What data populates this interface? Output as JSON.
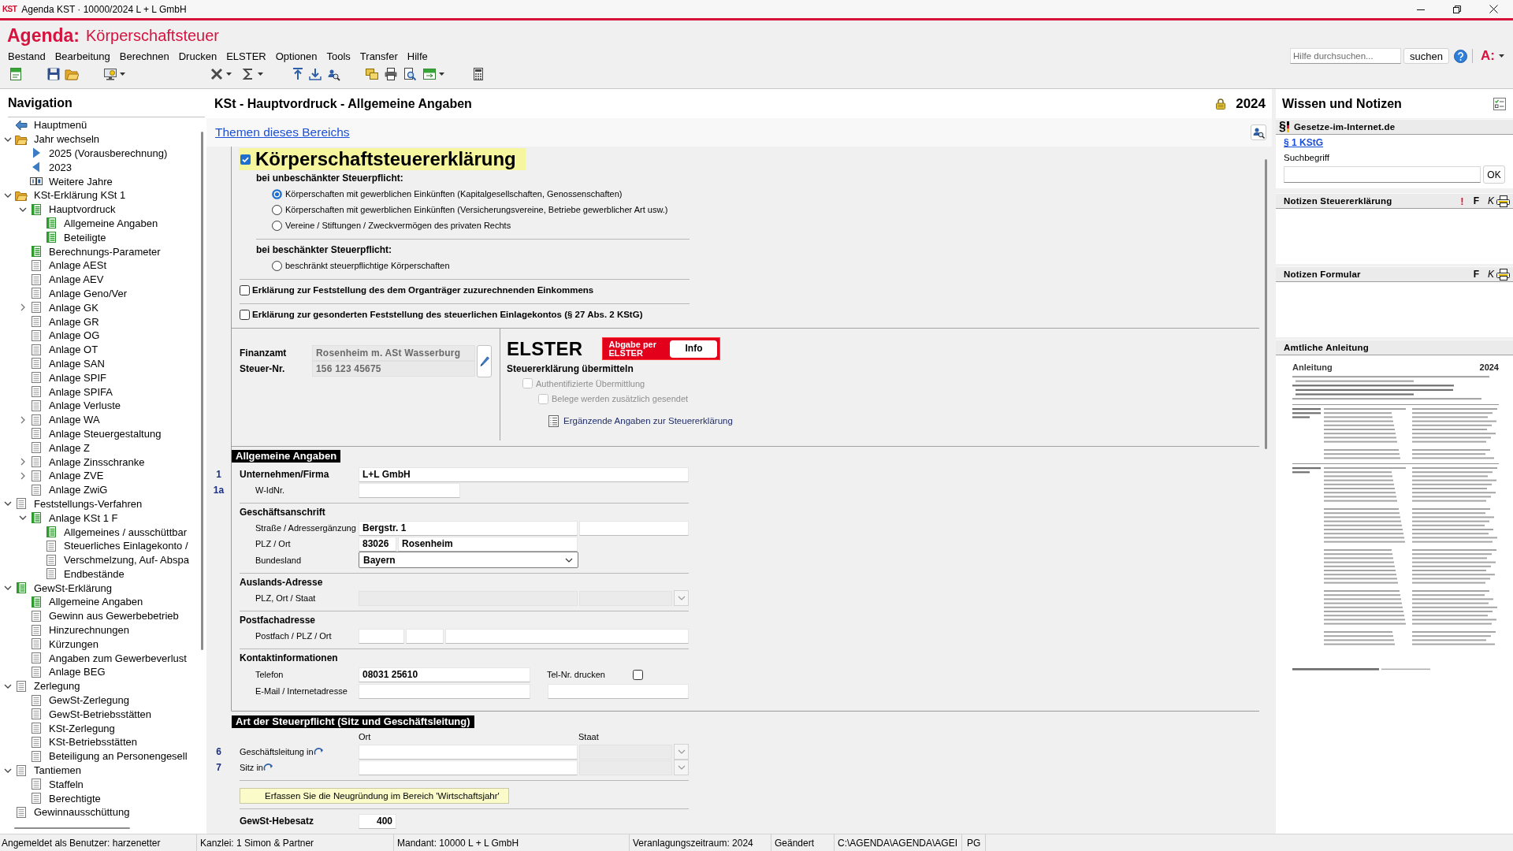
{
  "window": {
    "badge": "KST",
    "title": "Agenda KST · 10000/2024 L + L GmbH"
  },
  "header": {
    "brand": "Agenda:",
    "product": "Körperschaftsteuer",
    "menu": [
      "Bestand",
      "Bearbeitung",
      "Berechnen",
      "Drucken",
      "ELSTER",
      "Optionen",
      "Tools",
      "Transfer",
      "Hilfe"
    ],
    "help_search": {
      "placeholder": "Hilfe durchsuchen...",
      "button": "suchen"
    },
    "account_badge": "A:"
  },
  "navigation": {
    "title": "Navigation",
    "items": [
      {
        "label": "Hauptmenü",
        "kind": "back"
      },
      {
        "label": "Jahr wechseln",
        "kind": "folder",
        "expanded": true,
        "children": [
          {
            "label": "2025 (Vorausberechnung)",
            "kind": "next"
          },
          {
            "label": "2023",
            "kind": "previous"
          },
          {
            "label": "Weitere Jahre",
            "kind": "years"
          }
        ]
      },
      {
        "label": "KSt-Erklärung KSt 1",
        "kind": "folder",
        "expanded": true,
        "children": [
          {
            "label": "Hauptvordruck",
            "kind": "form",
            "filled": true,
            "expanded": true,
            "children": [
              {
                "label": "Allgemeine Angaben",
                "kind": "form",
                "filled": true
              },
              {
                "label": "Beteiligte",
                "kind": "form",
                "filled": true
              }
            ]
          },
          {
            "label": "Berechnungs-Parameter",
            "kind": "form",
            "filled": true
          },
          {
            "label": "Anlage AESt",
            "kind": "form",
            "filled": false
          },
          {
            "label": "Anlage AEV",
            "kind": "form",
            "filled": false
          },
          {
            "label": "Anlage Geno/Ver",
            "kind": "form",
            "filled": false
          },
          {
            "label": "Anlage GK",
            "kind": "form",
            "filled": false,
            "expanded": false
          },
          {
            "label": "Anlage GR",
            "kind": "form",
            "filled": false
          },
          {
            "label": "Anlage OG",
            "kind": "form",
            "filled": false
          },
          {
            "label": "Anlage OT",
            "kind": "form",
            "filled": false
          },
          {
            "label": "Anlage SAN",
            "kind": "form",
            "filled": false
          },
          {
            "label": "Anlage SPIF",
            "kind": "form",
            "filled": false
          },
          {
            "label": "Anlage SPIFA",
            "kind": "form",
            "filled": false
          },
          {
            "label": "Anlage Verluste",
            "kind": "form",
            "filled": false
          },
          {
            "label": "Anlage WA",
            "kind": "form",
            "filled": false,
            "expanded": false
          },
          {
            "label": "Anlage Steuergestaltung",
            "kind": "form",
            "filled": false
          },
          {
            "label": "Anlage Z",
            "kind": "form",
            "filled": false
          },
          {
            "label": "Anlage Zinsschranke",
            "kind": "form",
            "filled": false,
            "expanded": false
          },
          {
            "label": "Anlage ZVE",
            "kind": "form",
            "filled": false,
            "expanded": false
          },
          {
            "label": "Anlage ZwiG",
            "kind": "form",
            "filled": false
          }
        ]
      },
      {
        "label": "Feststellungs-Verfahren",
        "kind": "form",
        "filled": false,
        "expanded": true,
        "children": [
          {
            "label": "Anlage KSt 1 F",
            "kind": "form",
            "filled": true,
            "expanded": true,
            "children": [
              {
                "label": "Allgemeines / ausschüttbar",
                "kind": "form",
                "filled": true
              },
              {
                "label": "Steuerliches Einlagekonto /",
                "kind": "form",
                "filled": false
              },
              {
                "label": "Verschmelzung, Auf- Abspa",
                "kind": "form",
                "filled": false
              },
              {
                "label": "Endbestände",
                "kind": "form",
                "filled": false
              }
            ]
          }
        ]
      },
      {
        "label": "GewSt-Erklärung",
        "kind": "form",
        "filled": true,
        "expanded": true,
        "children": [
          {
            "label": "Allgemeine Angaben",
            "kind": "form",
            "filled": true
          },
          {
            "label": "Gewinn aus Gewerbebetrieb",
            "kind": "form",
            "filled": false
          },
          {
            "label": "Hinzurechnungen",
            "kind": "form",
            "filled": false
          },
          {
            "label": "Kürzungen",
            "kind": "form",
            "filled": false
          },
          {
            "label": "Angaben zum Gewerbeverlust",
            "kind": "form",
            "filled": false
          },
          {
            "label": "Anlage BEG",
            "kind": "form",
            "filled": false
          }
        ]
      },
      {
        "label": "Zerlegung",
        "kind": "form",
        "filled": false,
        "expanded": true,
        "children": [
          {
            "label": "GewSt-Zerlegung",
            "kind": "form",
            "filled": false
          },
          {
            "label": "GewSt-Betriebsstätten",
            "kind": "form",
            "filled": false
          },
          {
            "label": "KSt-Zerlegung",
            "kind": "form",
            "filled": false
          },
          {
            "label": "KSt-Betriebsstätten",
            "kind": "form",
            "filled": false
          },
          {
            "label": "Beteiligung an Personengesell",
            "kind": "form",
            "filled": false
          }
        ]
      },
      {
        "label": "Tantiemen",
        "kind": "form",
        "filled": false,
        "expanded": true,
        "children": [
          {
            "label": "Staffeln",
            "kind": "form",
            "filled": false
          },
          {
            "label": "Berechtigte",
            "kind": "form",
            "filled": false
          }
        ]
      },
      {
        "label": "Gewinnausschüttung",
        "kind": "form",
        "filled": false
      }
    ]
  },
  "form": {
    "title": "KSt - Hauptvordruck - Allgemeine Angaben",
    "locked": true,
    "year": "2024",
    "topics_link": "Themen dieses Bereichs",
    "declaration": {
      "checked": true,
      "title": "Körperschaftsteuererklärung",
      "groups": [
        {
          "heading": "bei unbeschänkter Steuerpflicht:",
          "options": [
            {
              "label": "Körperschaften mit gewerblichen Einkünften (Kapitalgesellschaften, Genossenschaften)",
              "selected": true
            },
            {
              "label": "Körperschaften mit gewerblichen Einkünften (Versicherungsvereine, Betriebe gewerblicher Art usw.)",
              "selected": false
            },
            {
              "label": "Vereine / Stiftungen / Zweckvermögen des privaten Rechts",
              "selected": false
            }
          ]
        },
        {
          "heading": "bei beschänkter Steuerpflicht:",
          "options": [
            {
              "label": "beschränkt steuerpflichtige Körperschaften",
              "selected": false
            }
          ]
        }
      ],
      "additional": [
        {
          "label": "Erklärung zur Feststellung des dem Organträger zuzurechnenden Einkommens",
          "checked": false
        },
        {
          "label": "Erklärung zur gesonderten Feststellung des steuerlichen Einlagekontos (§ 27 Abs. 2 KStG)",
          "checked": false
        }
      ]
    },
    "tax_office": [
      {
        "label": "Finanzamt",
        "value": "Rosenheim m. ASt Wasserburg"
      },
      {
        "label": "Steuer-Nr.",
        "value": "156 123 45675"
      }
    ],
    "elster": {
      "logo": "ELSTER",
      "submit_button": "Abgabe per ELSTER",
      "info_button": "Info",
      "heading": "Steuererklärung übermitteln",
      "options": [
        {
          "label": "Authentifizierte Übermittlung",
          "checked": false,
          "disabled": true,
          "children": [
            {
              "label": "Belege werden zusätzlich gesendet",
              "checked": false,
              "disabled": true
            }
          ]
        }
      ],
      "link": "Ergänzende Angaben zur Steuererklärung"
    },
    "sections": [
      {
        "title": "Allgemeine Angaben",
        "groups": [
          {
            "rows": [
              {
                "kind": "name",
                "line": "1",
                "label": "Unternehmen/Firma",
                "values": [
                  "L+L GmbH"
                ],
                "disabled": false
              },
              {
                "kind": "id",
                "line": "1a",
                "label": "W-IdNr.",
                "disabled": false
              }
            ]
          },
          {
            "heading": "Geschäftsanschrift",
            "rows": [
              {
                "kind": "street",
                "label": "Straße / Adressergänzung",
                "values": [
                  "Bergstr. 1"
                ],
                "disabled": false
              },
              {
                "kind": "city",
                "label": "PLZ / Ort",
                "values": [
                  "83026",
                  "Rosenheim"
                ],
                "disabled": false
              },
              {
                "kind": "select",
                "label": "Bundesland",
                "values": [
                  "Bayern"
                ],
                "disabled": false
              }
            ]
          },
          {
            "heading": "Auslands-Adresse",
            "rows": [
              {
                "kind": "foreign",
                "label": "PLZ, Ort / Staat",
                "disabled": true
              }
            ]
          },
          {
            "heading": "Postfachadresse",
            "rows": [
              {
                "kind": "postbox",
                "label": "Postfach / PLZ / Ort",
                "disabled": false
              }
            ]
          },
          {
            "heading": "Kontaktinformationen",
            "rows": [
              {
                "kind": "phone",
                "label": "Telefon",
                "values": [
                  "08031 25610"
                ],
                "disabled": false,
                "option": {
                  "label": "Tel-Nr. drucken",
                  "checked": false
                }
              },
              {
                "kind": "email",
                "label": "E-Mail / Internetadresse",
                "disabled": false
              }
            ]
          }
        ]
      },
      {
        "title": "Art der Steuerpflicht (Sitz und Geschäftsleitung)",
        "columns": [
          "Ort",
          "Staat"
        ],
        "groups": [
          {
            "rows": [
              {
                "kind": "seat",
                "line": "6",
                "label": "Geschäftsleitung in",
                "disabled": false,
                "country_disabled": true
              },
              {
                "kind": "seat",
                "line": "7",
                "label": "Sitz in",
                "disabled": false,
                "country_disabled": true
              }
            ]
          },
          {
            "rows": [
              {
                "kind": "notice",
                "label": "Erfassen Sie die Neugründung im Bereich 'Wirtschaftsjahr'"
              }
            ]
          },
          {
            "rows": [
              {
                "kind": "rate",
                "label": "GewSt-Hebesatz",
                "values": [
                  "400"
                ],
                "disabled": false
              }
            ]
          }
        ]
      }
    ]
  },
  "knowledge": {
    "title": "Wissen und Notizen",
    "law": {
      "mark": "§",
      "heading": "Gesetze-im-Internet.de",
      "link": "§ 1 KStG",
      "search_label": "Suchbegriff",
      "search_button": "OK"
    },
    "notes": [
      {
        "title": "Notizen Steuererklärung",
        "flag": "!",
        "bold_button": "F",
        "italic_button": "K"
      },
      {
        "title": "Notizen Formular",
        "bold_button": "F",
        "italic_button": "K"
      }
    ],
    "guide": {
      "heading": "Amtliche Anleitung",
      "doc_title": "Anleitung",
      "doc_year": "2024"
    }
  },
  "status_bar": [
    "Angemeldet als Benutzer: harzenetter",
    "Kanzlei: 1 Simon & Partner",
    "Mandant: 10000 L + L GmbH",
    "Veranlagungszeitraum: 2024",
    "Geändert",
    "C:\\AGENDA\\AGENDA\\AGEI",
    "PG"
  ]
}
